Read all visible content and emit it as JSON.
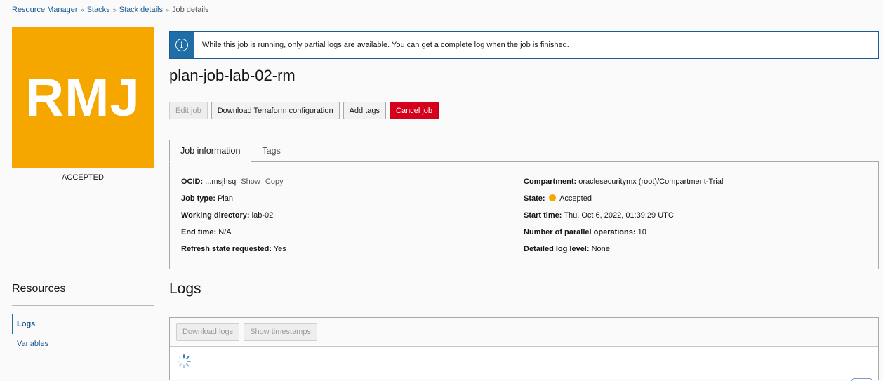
{
  "breadcrumb": {
    "items": [
      "Resource Manager",
      "Stacks",
      "Stack details"
    ],
    "current": "Job details"
  },
  "logo": {
    "text": "RMJ",
    "status": "ACCEPTED",
    "color": "#f5a700"
  },
  "banner": {
    "message": "While this job is running, only partial logs are available. You can get a complete log when the job is finished."
  },
  "job": {
    "title": "plan-job-lab-02-rm"
  },
  "actions": {
    "edit": "Edit job",
    "download_tf": "Download Terraform configuration",
    "add_tags": "Add tags",
    "cancel": "Cancel job"
  },
  "tabs": {
    "info": "Job information",
    "tags": "Tags"
  },
  "details": {
    "ocid_label": "OCID:",
    "ocid_value": "...msjhsq",
    "show": "Show",
    "copy": "Copy",
    "job_type_label": "Job type:",
    "job_type_value": "Plan",
    "working_dir_label": "Working directory:",
    "working_dir_value": "lab-02",
    "end_time_label": "End time:",
    "end_time_value": "N/A",
    "refresh_label": "Refresh state requested:",
    "refresh_value": "Yes",
    "compartment_label": "Compartment:",
    "compartment_value": "oraclesecuritymx (root)/Compartment-Trial",
    "state_label": "State:",
    "state_value": "Accepted",
    "start_time_label": "Start time:",
    "start_time_value": "Thu, Oct 6, 2022, 01:39:29 UTC",
    "parallel_label": "Number of parallel operations:",
    "parallel_value": "10",
    "log_level_label": "Detailed log level:",
    "log_level_value": "None"
  },
  "resources": {
    "title": "Resources",
    "items": [
      "Logs",
      "Variables"
    ]
  },
  "logs": {
    "title": "Logs",
    "download": "Download logs",
    "timestamps": "Show timestamps"
  }
}
